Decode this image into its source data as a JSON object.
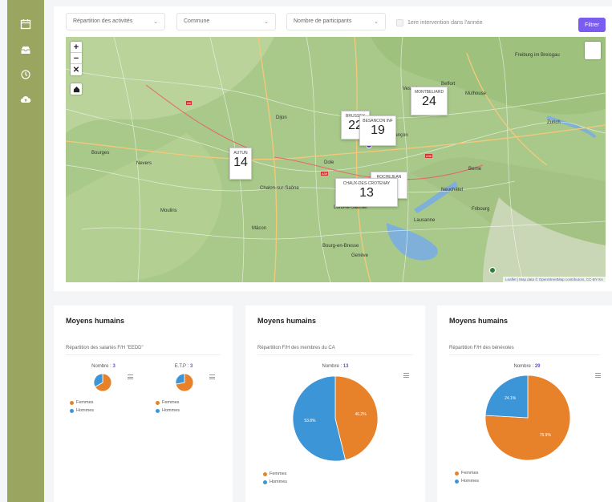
{
  "filters": {
    "activites": "Répartition des activités",
    "commune": "Commune",
    "participants": "Nombre de participants",
    "checkbox_label": "1ere intervention dans l'année",
    "button": "Filtrer"
  },
  "map": {
    "attribution": "Leaflet | Map data © OpenStreetMap contributors, CC-BY-SA",
    "cities": [
      "Freiburg im Breisgau",
      "Zurich",
      "Berne",
      "Lausanne",
      "Genève",
      "Mulhouse",
      "Dijon",
      "Chalon-sur-Saône",
      "Mâcon",
      "Bourg-en-Bresse",
      "Besançon",
      "Nevers",
      "Bourges",
      "Moulins",
      "Dole",
      "Lons-le-Saunier",
      "Neuchâtel",
      "Fribourg",
      "Vesoul",
      "Belfort"
    ],
    "markers": [
      {
        "name": "MONTBELIARD",
        "count": "24"
      },
      {
        "name": "BRUSSEY",
        "count": "22"
      },
      {
        "name": "BESANCON INF",
        "count": "19"
      },
      {
        "name": "AUTUN",
        "count": "14"
      },
      {
        "name": "CHAUX-DES-CROTENAY",
        "count": "13"
      },
      {
        "name": "ROCHEJEAN",
        "count": "6"
      }
    ]
  },
  "cards": [
    {
      "title": "Moyens humains",
      "subtitle": "Répartition des salariés F/H \"EEDD\"",
      "charts": [
        {
          "label": "Nombre : ",
          "value": "3",
          "slices": [
            {
              "label": "Femmes",
              "value": 66.7
            },
            {
              "label": "Hommes",
              "value": 33.3
            }
          ]
        },
        {
          "label": "E.T.P : ",
          "value": "3",
          "slices": [
            {
              "label": "Femmes",
              "value": 72
            },
            {
              "label": "Hommes",
              "value": 28
            }
          ]
        }
      ]
    },
    {
      "title": "Moyens humains",
      "subtitle": "Répartition F/H des membres du CA",
      "charts": [
        {
          "label": "Nombre : ",
          "value": "13",
          "slices": [
            {
              "label": "Femmes",
              "value": 46.2,
              "text": "46.2%"
            },
            {
              "label": "Hommes",
              "value": 53.8,
              "text": "53.8%"
            }
          ]
        }
      ]
    },
    {
      "title": "Moyens humains",
      "subtitle": "Répartition F/H des bénévoles",
      "charts": [
        {
          "label": "Nombre : ",
          "value": "29",
          "slices": [
            {
              "label": "Femmes",
              "value": 75.9,
              "text": "75.9%"
            },
            {
              "label": "Hommes",
              "value": 24.1,
              "text": "24.1%"
            }
          ]
        }
      ]
    }
  ],
  "legend": {
    "femmes": "Femmes",
    "hommes": "Hommes"
  },
  "colors": {
    "femmes": "#e8822a",
    "hommes": "#3b95d6",
    "accent": "#7a5cf0",
    "sidebar": "#9aa55f"
  },
  "sidebar": {
    "icons": [
      "calendar-icon",
      "inbox-icon",
      "clock-icon",
      "cloud-icon"
    ]
  }
}
